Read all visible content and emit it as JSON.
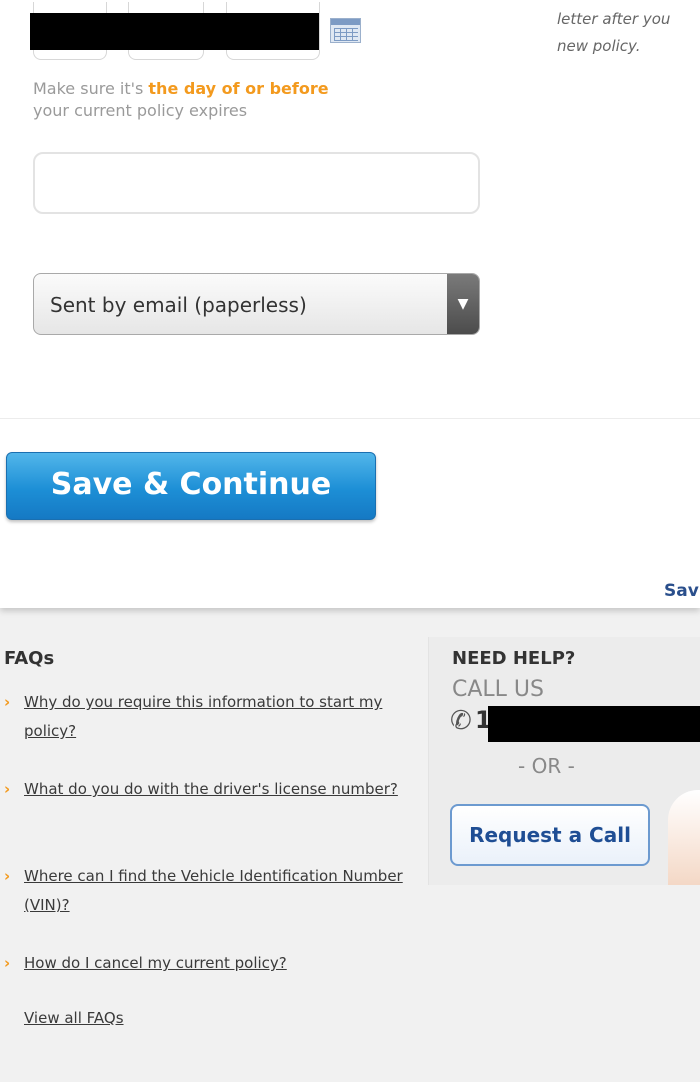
{
  "form": {
    "start_date_hint_prefix": "Make sure it's ",
    "start_date_hint_highlight": "the day of or before",
    "start_date_hint_suffix": "your current policy expires",
    "side_note_line1": "letter after you",
    "side_note_line2": "new policy.",
    "text_field_value": "",
    "delivery_select_value": "Sent by email (paperless)",
    "select_arrow": "▼",
    "save_continue_label": "Save & Continue",
    "save_link_label": "Sav"
  },
  "faqs": {
    "title": "FAQs",
    "bullet": "›",
    "items": [
      {
        "question": "Why do you require this information to start my policy?"
      },
      {
        "question": "What do you do with the driver's license number?"
      },
      {
        "question": "Where can I find the Vehicle Identification Number (VIN)?"
      },
      {
        "question": "How do I cancel my current policy?"
      }
    ],
    "view_all": "View all FAQs"
  },
  "help": {
    "title": "NEED HELP?",
    "call_us": "CALL US",
    "phone_icon": "phone-icon",
    "phone_glyph": "✆",
    "phone_first_digit": "1",
    "or_text": "- OR -",
    "request_call_label": "Request a Call"
  },
  "colors": {
    "accent_orange": "#f39a1e",
    "primary_blue": "#1d8fd6",
    "link_navy": "#2a4f8c"
  }
}
